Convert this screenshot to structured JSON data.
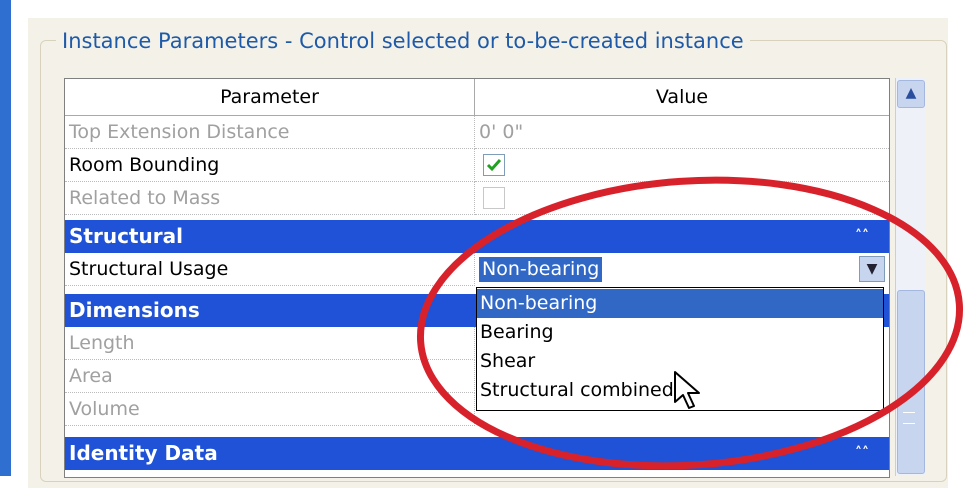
{
  "groupbox": {
    "title": "Instance Parameters - Control selected or to-be-created instance"
  },
  "table": {
    "headers": {
      "parameter": "Parameter",
      "value": "Value"
    },
    "rows_top": [
      {
        "label": "Top Extension Distance",
        "value": "0'  0\"",
        "enabled": false
      },
      {
        "label": "Room Bounding",
        "checked": true,
        "enabled": true
      },
      {
        "label": "Related to Mass",
        "checked": false,
        "enabled": false
      }
    ],
    "groups": {
      "structural": "Structural",
      "dimensions": "Dimensions",
      "identity": "Identity Data"
    },
    "structural_usage": {
      "label": "Structural Usage",
      "value": "Non-bearing"
    },
    "dimensions_rows": [
      "Length",
      "Area",
      "Volume"
    ],
    "collapse_icon": "chevron-double-up-icon"
  },
  "dropdown": {
    "options": [
      "Non-bearing",
      "Bearing",
      "Shear",
      "Structural combined"
    ],
    "selected_index": 0
  },
  "annotation": {
    "shape": "red-ellipse",
    "color": "#d8222b"
  },
  "colors": {
    "group_header": "#1f52d6",
    "selection": "#3168c6",
    "legend_text": "#1e5aa8"
  }
}
